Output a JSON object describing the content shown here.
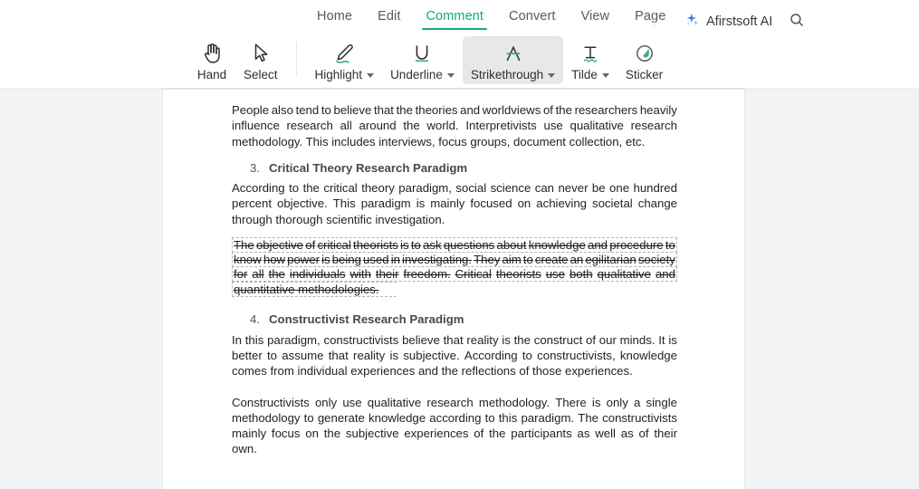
{
  "menu": {
    "tabs": [
      {
        "label": "Home",
        "active": false
      },
      {
        "label": "Edit",
        "active": false
      },
      {
        "label": "Comment",
        "active": true
      },
      {
        "label": "Convert",
        "active": false
      },
      {
        "label": "View",
        "active": false
      },
      {
        "label": "Page",
        "active": false
      }
    ],
    "brand": "Afirstsoft AI",
    "brand_icon": "sparkle-icon",
    "search_icon": "search-icon",
    "active_color": "#16a97a",
    "brand_icon_color": "#2f80ed"
  },
  "toolbar": {
    "tools": [
      {
        "label": "Hand",
        "icon": "hand-icon",
        "caret": false,
        "selected": false
      },
      {
        "label": "Select",
        "icon": "cursor-arrow-icon",
        "caret": false,
        "selected": false
      },
      {
        "label": "Highlight",
        "icon": "highlighter-pen-icon",
        "caret": true,
        "selected": false
      },
      {
        "label": "Underline",
        "icon": "underline-u-icon",
        "caret": true,
        "selected": false
      },
      {
        "label": "Strikethrough",
        "icon": "strikethrough-a-icon",
        "caret": true,
        "selected": true
      },
      {
        "label": "Tilde",
        "icon": "tilde-t-icon",
        "caret": true,
        "selected": false
      },
      {
        "label": "Sticker",
        "icon": "sticker-leaf-icon",
        "caret": false,
        "selected": false
      }
    ],
    "accent_color": "#3aab82",
    "selected_bg": "#e7e8e8"
  },
  "document": {
    "paragraph_1": {
      "l1": [
        "People",
        "also",
        "tend",
        "to",
        "believe",
        "that",
        "the",
        "theories",
        "and",
        "worldviews",
        "of",
        "the",
        "researchers",
        "heavily"
      ],
      "l2": [
        "influence",
        "research",
        "all",
        "around",
        "the",
        "world.",
        "Interpretivists",
        "use",
        "qualitative",
        "research"
      ],
      "l3": "methodology. This includes interviews, focus groups, document collection, etc."
    },
    "heading_3": {
      "num": "3.",
      "text": "Critical Theory Research Paradigm"
    },
    "paragraph_2": {
      "l1": [
        "According",
        "to",
        "the",
        "critical",
        "theory",
        "paradigm,",
        "social",
        "science",
        "can",
        "never",
        "be",
        "one",
        "hundred"
      ],
      "l2": [
        "percent",
        "objective.",
        "This",
        "paradigm",
        "is",
        "mainly",
        "focused",
        "on",
        "achieving",
        "societal",
        "change"
      ],
      "l3": "through thorough scientific investigation."
    },
    "struck_paragraph": {
      "l1": [
        "The",
        "objective",
        "of",
        "critical",
        "theorists",
        "is",
        "to",
        "ask",
        "questions",
        "about",
        "knowledge",
        "and",
        "procedure",
        "to"
      ],
      "l2": [
        "know",
        "how",
        "power",
        "is",
        "being",
        "used",
        "in",
        "investigating.",
        "They",
        "aim",
        "to",
        "create",
        "an",
        "egilitarian",
        "society"
      ],
      "l3": [
        "for",
        "all",
        "the",
        "individuals",
        "with",
        "their",
        "freedom.",
        "Critical",
        "theorists",
        "use",
        "both",
        "qualitative",
        "and"
      ],
      "l4": "quantitative methodologies."
    },
    "heading_4": {
      "num": "4.",
      "text": "Constructivist Research Paradigm"
    },
    "paragraph_3": {
      "l1": [
        "In",
        "this",
        "paradigm,",
        "constructivists",
        "believe",
        "that",
        "reality",
        "is",
        "the",
        "construct",
        "of",
        "our",
        "minds.",
        "It",
        "is"
      ],
      "l2": [
        "better",
        "to",
        "assume",
        "that",
        "reality",
        "is",
        "subjective.",
        "According",
        "to",
        "constructivists,",
        "knowledge"
      ],
      "l3": "comes from individual experiences and the reflections of those experiences."
    },
    "paragraph_4": {
      "l1": [
        "Constructivists",
        "only",
        "use",
        "qualitative",
        "research",
        "methodology.",
        "There",
        "is",
        "only",
        "a",
        "single"
      ],
      "l2": [
        "methodology",
        "to",
        "generate",
        "knowledge",
        "according",
        "to",
        "this",
        "paradigm.",
        "The",
        "constructivists"
      ],
      "l3": "mainly focus on the subjective experiences of the participants as well as of their own."
    }
  },
  "canvas": {
    "background_color": "#f1f3f4",
    "page_color": "#ffffff"
  }
}
